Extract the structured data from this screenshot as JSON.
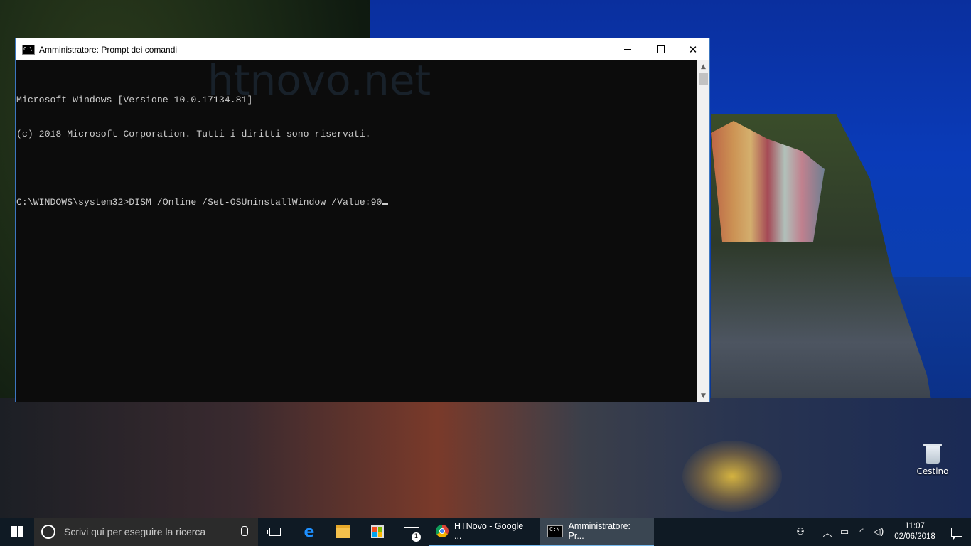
{
  "window": {
    "title": "Amministratore: Prompt dei comandi",
    "minimize_glyph": "",
    "close_glyph": "✕",
    "cmd_icon_text": "C:\\"
  },
  "console": {
    "lines": [
      "Microsoft Windows [Versione 10.0.17134.81]",
      "(c) 2018 Microsoft Corporation. Tutti i diritti sono riservati.",
      "",
      "C:\\WINDOWS\\system32>DISM /Online /Set-OSUninstallWindow /Value:90"
    ],
    "watermark": "htnovo.net"
  },
  "scrollbar": {
    "up": "▲",
    "down": "▼"
  },
  "desktop": {
    "recycle_bin_label": "Cestino"
  },
  "taskbar": {
    "search_placeholder": "Scrivi qui per eseguire la ricerca",
    "edge_glyph": "e",
    "mail_badge": "1",
    "apps": [
      {
        "label": "HTNovo - Google ...",
        "icon": "chrome-icon"
      },
      {
        "label": "Amministratore: Pr...",
        "icon": "cmd-icon"
      }
    ],
    "tray": {
      "people_glyph": "⚇",
      "chevron_glyph": "︿",
      "battery_glyph": "▭",
      "wifi_glyph": "◜",
      "volume_glyph": "◁)",
      "time": "11:07",
      "date": "02/06/2018"
    }
  }
}
